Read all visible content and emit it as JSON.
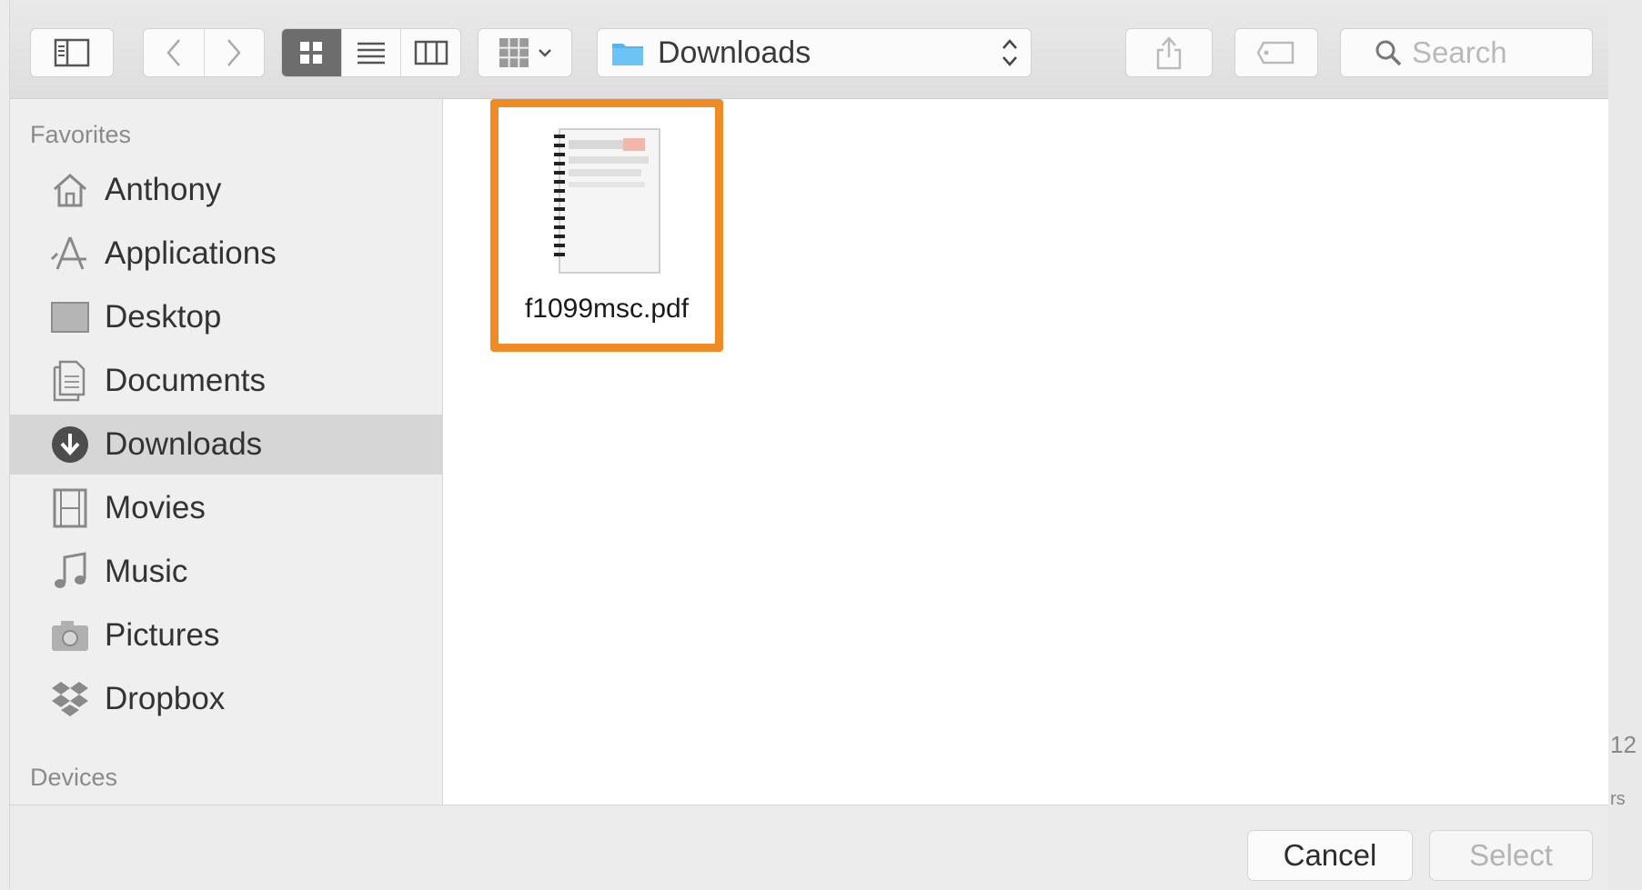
{
  "toolbar": {
    "location": "Downloads",
    "search_placeholder": "Search"
  },
  "sidebar": {
    "favorites_header": "Favorites",
    "items": [
      {
        "label": "Anthony",
        "icon": "home-icon"
      },
      {
        "label": "Applications",
        "icon": "applications-icon"
      },
      {
        "label": "Desktop",
        "icon": "desktop-icon"
      },
      {
        "label": "Documents",
        "icon": "documents-icon"
      },
      {
        "label": "Downloads",
        "icon": "downloads-icon",
        "selected": true
      },
      {
        "label": "Movies",
        "icon": "movies-icon"
      },
      {
        "label": "Music",
        "icon": "music-icon"
      },
      {
        "label": "Pictures",
        "icon": "pictures-icon"
      },
      {
        "label": "Dropbox",
        "icon": "dropbox-icon"
      }
    ],
    "devices_header": "Devices"
  },
  "content": {
    "files": [
      {
        "name": "f1099msc.pdf",
        "icon": "pdf-document-icon",
        "highlighted": true
      }
    ]
  },
  "buttons": {
    "cancel": "Cancel",
    "select": "Select"
  },
  "edge_fragments": [
    "12",
    "rs"
  ],
  "colors": {
    "highlight": "#f08a24",
    "selected_row": "#d6d6d6"
  }
}
